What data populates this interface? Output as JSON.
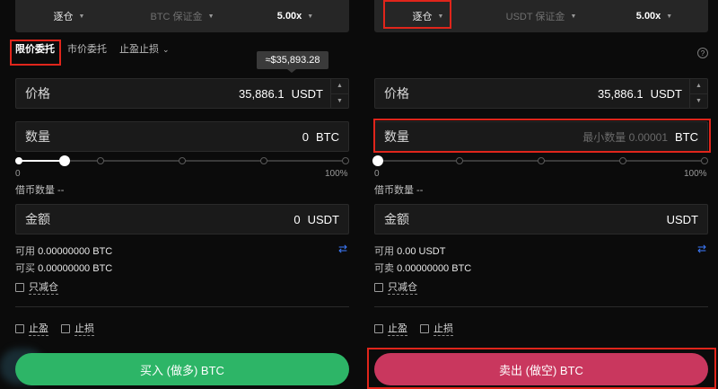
{
  "left": {
    "topbar": {
      "margin_mode": "逐仓",
      "margin_asset": "BTC 保证金",
      "leverage": "5.00x"
    },
    "tabs": [
      "限价委托",
      "市价委托",
      "止盈止损"
    ],
    "tooltip": "≈$35,893.28",
    "price": {
      "label": "价格",
      "value": "35,886.1",
      "unit": "USDT"
    },
    "quantity": {
      "label": "数量",
      "value": "0",
      "unit": "BTC"
    },
    "slider": {
      "min_label": "0",
      "max_label": "100%",
      "percent": 12
    },
    "borrow": "借币数量 --",
    "amount": {
      "label": "金额",
      "value": "0",
      "unit": "USDT"
    },
    "available_label": "可用",
    "available_value": "0.00000000 BTC",
    "buyable_label": "可买",
    "buyable_value": "0.00000000 BTC",
    "reduce_only": "只减仓",
    "take_profit": "止盈",
    "stop_loss": "止损",
    "action": "买入 (做多) BTC"
  },
  "right": {
    "topbar": {
      "margin_mode": "逐仓",
      "margin_asset": "USDT 保证金",
      "leverage": "5.00x"
    },
    "price": {
      "label": "价格",
      "value": "35,886.1",
      "unit": "USDT"
    },
    "quantity": {
      "label": "数量",
      "placeholder": "最小数量 0.00001",
      "unit": "BTC"
    },
    "slider": {
      "min_label": "0",
      "max_label": "100%",
      "percent": 0
    },
    "borrow": "借币数量 --",
    "amount": {
      "label": "金额",
      "unit": "USDT"
    },
    "available_label": "可用",
    "available_value": "0.00 USDT",
    "sellable_label": "可卖",
    "sellable_value": "0.00000000 BTC",
    "reduce_only": "只减仓",
    "take_profit": "止盈",
    "stop_loss": "止损",
    "action": "卖出 (做空) BTC"
  },
  "icons": {
    "help": "?",
    "swap": "⇄",
    "caret": "▼",
    "chevron": "⌄"
  },
  "colors": {
    "buy": "#2db567",
    "sell": "#c9375e",
    "accent": "#3d7bff",
    "highlight": "#e0251b"
  }
}
